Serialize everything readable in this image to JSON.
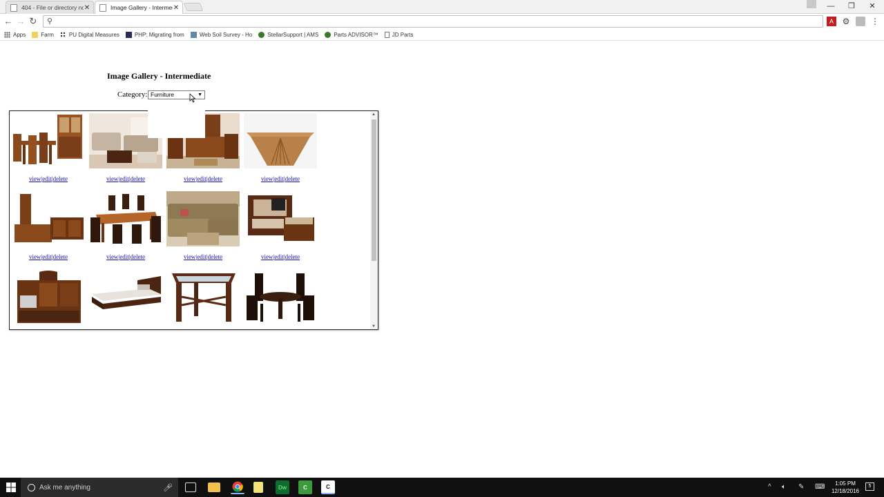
{
  "browser": {
    "tabs": [
      {
        "title": "404 - File or directory no",
        "active": false
      },
      {
        "title": "Image Gallery - Intermed",
        "active": true
      }
    ],
    "address": "",
    "bookmarks": [
      {
        "label": "Apps",
        "icon": "apps-grid-icon"
      },
      {
        "label": "Farm",
        "icon": "folder-icon"
      },
      {
        "label": "PU Digital Measures",
        "icon": "dots-icon"
      },
      {
        "label": "PHP: Migrating from",
        "icon": "php-icon"
      },
      {
        "label": "Web Soil Survey - Ho",
        "icon": "map-icon"
      },
      {
        "label": "StellarSupport | AMS",
        "icon": "deere-icon"
      },
      {
        "label": "Parts ADVISOR™",
        "icon": "deere-icon"
      },
      {
        "label": "JD Parts",
        "icon": "page-icon"
      }
    ]
  },
  "page": {
    "title": "Image Gallery - Intermediate",
    "category_label": "Category:",
    "category_value": "Furniture",
    "action_labels": {
      "view": "view",
      "edit": "edit",
      "delete": "delete",
      "sep": "|"
    },
    "items": [
      {
        "name": "dining-hutch-set"
      },
      {
        "name": "living-room-set"
      },
      {
        "name": "bedroom-set"
      },
      {
        "name": "wooden-folding-table"
      },
      {
        "name": "cabinet-set"
      },
      {
        "name": "dining-table-chairs"
      },
      {
        "name": "sectional-sofa"
      },
      {
        "name": "armchair-ottoman"
      },
      {
        "name": "entertainment-center"
      },
      {
        "name": "platform-bed"
      },
      {
        "name": "glass-top-table"
      },
      {
        "name": "round-dining-set"
      }
    ]
  },
  "taskbar": {
    "search_placeholder": "Ask me anything",
    "time": "1:05 PM",
    "date": "12/18/2016",
    "notifications": "5"
  },
  "colors": {
    "link": "#1a0dab",
    "wood": "#8a4a1c",
    "dark_wood": "#4a2512",
    "taskbar": "#101010"
  }
}
